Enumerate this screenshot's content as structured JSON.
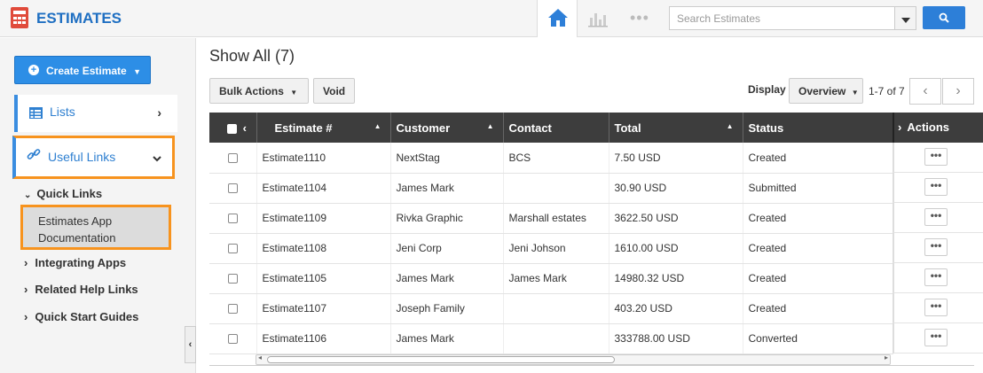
{
  "header": {
    "app_title": "ESTIMATES",
    "search_placeholder": "Search Estimates",
    "nav": [
      "home-icon",
      "chart-icon",
      "more-icon"
    ]
  },
  "sidebar": {
    "create_label": "Create Estimate",
    "lists_label": "Lists",
    "useful_links_label": "Useful Links",
    "quick_links_title": "Quick Links",
    "quick_link_item_line1": "Estimates App",
    "quick_link_item_line2": "Documentation",
    "links": [
      "Integrating Apps",
      "Related Help Links",
      "Quick Start Guides"
    ]
  },
  "main": {
    "title": "Show All (7)",
    "bulk_actions": "Bulk Actions",
    "void": "Void",
    "display_label": "Display",
    "display_value": "Overview",
    "pager_text": "1-7 of 7"
  },
  "table": {
    "columns": [
      "Estimate #",
      "Customer",
      "Contact",
      "Total",
      "Status"
    ],
    "actions_header": "Actions",
    "rows": [
      [
        "Estimate1110",
        "NextStag",
        "BCS",
        "7.50  USD",
        "Created"
      ],
      [
        "Estimate1104",
        "James Mark",
        "",
        "30.90  USD",
        "Submitted"
      ],
      [
        "Estimate1109",
        "Rivka Graphic",
        "Marshall estates",
        "3622.50  USD",
        "Created"
      ],
      [
        "Estimate1108",
        "Jeni Corp",
        "Jeni Johson",
        "1610.00  USD",
        "Created"
      ],
      [
        "Estimate1105",
        "James Mark",
        "James Mark",
        "14980.32  USD",
        "Created"
      ],
      [
        "Estimate1107",
        "Joseph Family",
        "",
        "403.20  USD",
        "Created"
      ],
      [
        "Estimate1106",
        "James Mark",
        "",
        "333788.00  USD",
        "Converted"
      ]
    ]
  },
  "colors": {
    "brand": "#1f6fc2",
    "accent": "#2d8ee6",
    "highlight": "#f7931e",
    "header_bg": "#3d3d3d"
  }
}
